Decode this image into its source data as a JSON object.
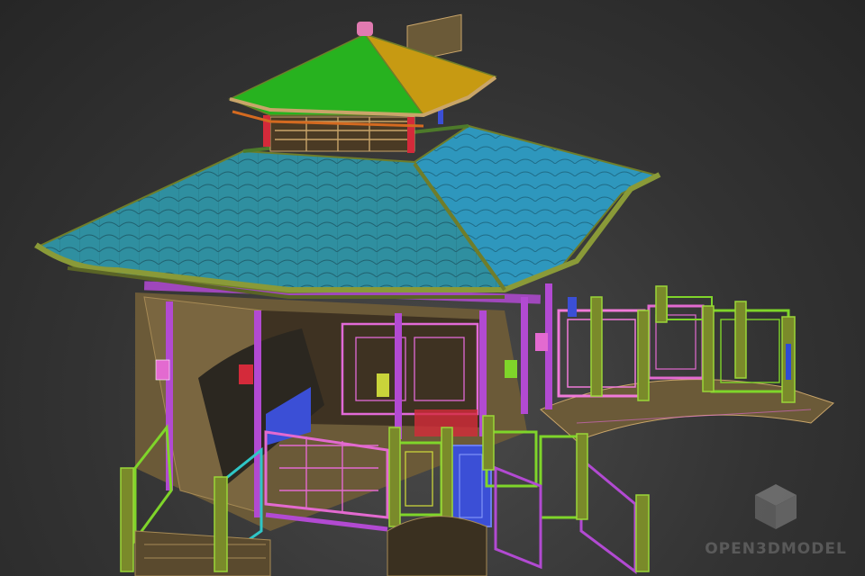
{
  "watermark": {
    "text": "OPEN3DMODEL",
    "icon": "cube-icon"
  },
  "colors": {
    "top_roof_green": "#27b21f",
    "top_roof_gold": "#c79a12",
    "main_roof_teal": "#2f8fa0",
    "main_roof_blue": "#2d95b9",
    "eave_olive": "#6f7d2a",
    "wall_tan": "#6b5a38",
    "rail_pink": "#e26ad7",
    "rail_green": "#7fd52a",
    "rail_blue": "#3b4fd6",
    "post_magenta": "#b24ad2",
    "lantern_red": "#d42a3a",
    "background": "#333333"
  }
}
